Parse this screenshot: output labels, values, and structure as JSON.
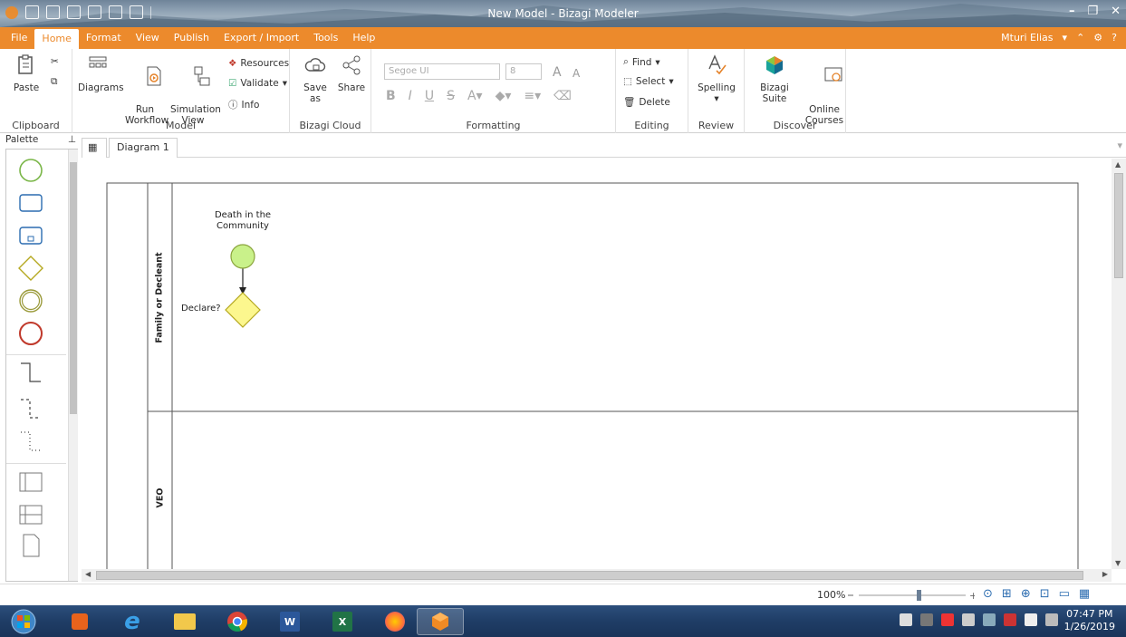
{
  "window": {
    "title": "New Model - Bizagi Modeler"
  },
  "menu": {
    "items": [
      "File",
      "Home",
      "Format",
      "View",
      "Publish",
      "Export / Import",
      "Tools",
      "Help"
    ],
    "active": "Home",
    "user": "Mturi Elias"
  },
  "ribbon": {
    "clipboard": {
      "paste": "Paste",
      "label": "Clipboard"
    },
    "model": {
      "diagrams": "Diagrams",
      "run_workflow": "Run\nWorkflow",
      "simulation_view": "Simulation\nView",
      "resources": "Resources",
      "validate": "Validate",
      "info": "Info",
      "label": "Model"
    },
    "cloud": {
      "save_as": "Save as",
      "share": "Share",
      "label": "Bizagi Cloud"
    },
    "formatting": {
      "font": "Segoe UI",
      "size": "8",
      "label": "Formatting"
    },
    "editing": {
      "find": "Find",
      "select": "Select",
      "delete": "Delete",
      "label": "Editing"
    },
    "review": {
      "spelling": "Spelling",
      "label": "Review"
    },
    "discover": {
      "suite": "Bizagi Suite",
      "courses": "Online\nCourses",
      "label": "Discover"
    }
  },
  "palette": {
    "title": "Palette"
  },
  "tabs": {
    "diagram": "Diagram 1"
  },
  "diagram": {
    "lanes": [
      {
        "name": "Family or Decleant"
      },
      {
        "name": "VEO"
      }
    ],
    "start_event": "Death in the\nCommunity",
    "gateway": "Declare?",
    "colors": {
      "event_fill": "#c9f18a",
      "gateway_fill": "#fcf78e",
      "outline": "#8aa43c"
    }
  },
  "status": {
    "zoom": "100%"
  },
  "taskbar": {
    "time": "07:47 PM",
    "date": "1/26/2019"
  }
}
